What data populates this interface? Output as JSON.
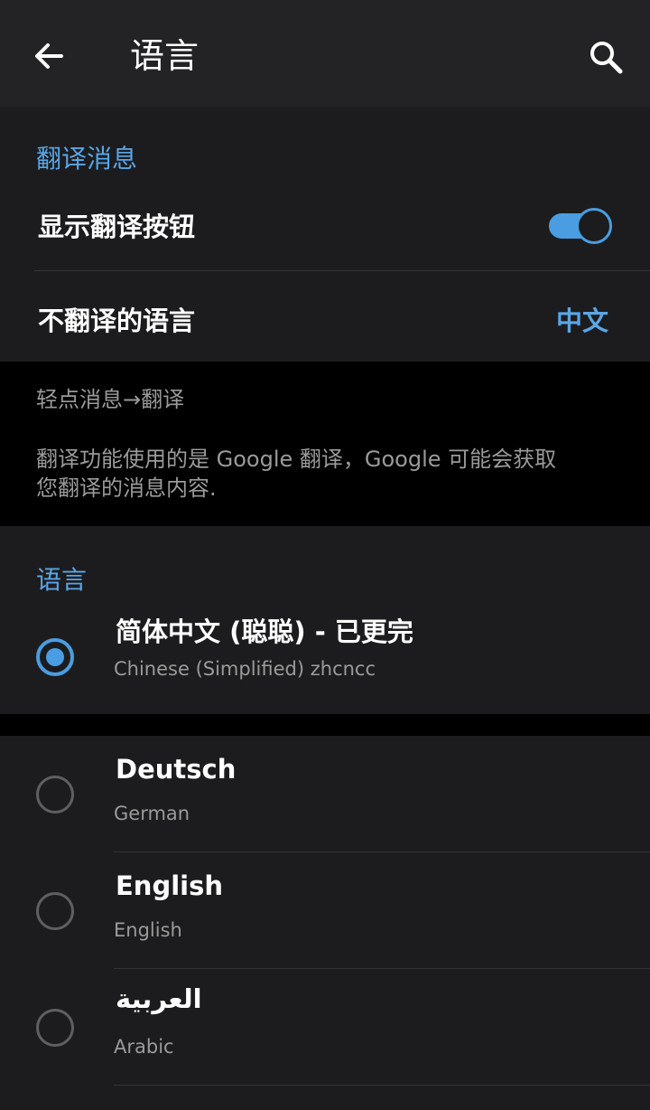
{
  "appbar": {
    "title": "语言",
    "back_icon": "arrow-back-icon",
    "search_icon": "search-icon"
  },
  "translate_section": {
    "header": "翻译消息",
    "show_button_label": "显示翻译按钮",
    "show_button_on": true,
    "do_not_translate_label": "不翻译的语言",
    "do_not_translate_value": "中文"
  },
  "info": {
    "line1": "轻点消息→翻译",
    "line2": "翻译功能使用的是 Google 翻译，Google 可能会获取",
    "line3": "您翻译的消息内容."
  },
  "language_section": {
    "header": "语言",
    "current": {
      "name": "简体中文 (聪聪) - 已更完",
      "sub": "Chinese (Simplified) zhcncc",
      "selected": true
    },
    "items": [
      {
        "name": "Deutsch",
        "sub": "German",
        "selected": false
      },
      {
        "name": "English",
        "sub": "English",
        "selected": false
      },
      {
        "name": "العربية",
        "sub": "Arabic",
        "selected": false
      }
    ]
  },
  "colors": {
    "accent": "#4a9de0",
    "background": "#000000",
    "card": "#1c1c1e",
    "appbar": "#232326"
  }
}
